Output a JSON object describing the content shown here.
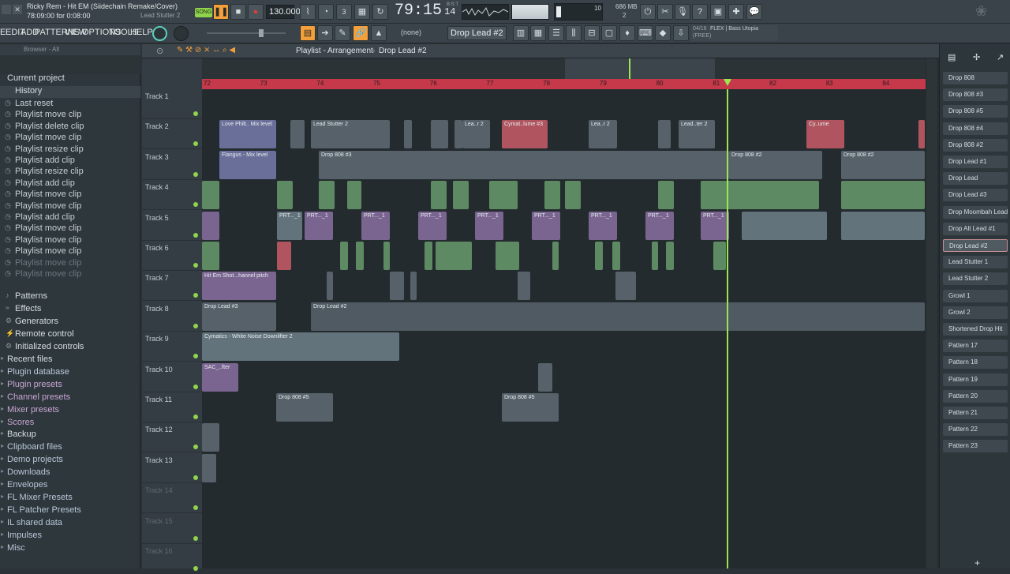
{
  "window": {
    "title": "Ricky Rem - Hit EM (Siidechain Remake/Cover)",
    "time_info": "78:09:00 for 0:08:00",
    "hint_text": "Lead Stutter 2"
  },
  "transport": {
    "mode_label": "SONG",
    "tempo": "130.000",
    "time_display": "79:15",
    "time_sub": "14",
    "time_unit": "B:S:T",
    "cpu_value": "10",
    "memory": "686 MB",
    "voices": "2"
  },
  "menu": {
    "items": [
      "E",
      "EDIT",
      "ADD",
      "PATTERNS",
      "VIEW",
      "OPTIONS",
      "TOOLS",
      "HELP"
    ]
  },
  "toolbar": {
    "preset_none": "(none)",
    "pattern_selector": "Drop Lead #2",
    "news_counter": "04/16",
    "news_text": "FLEX | Bass Utopia",
    "news_sub": "(FREE)"
  },
  "browser": {
    "header": "Browser - All",
    "current_project": "Current project",
    "history_label": "History",
    "history_items": [
      "Last reset",
      "Playlist move clip",
      "Playlist delete clip",
      "Playlist move clip",
      "Playlist resize clip",
      "Playlist add clip",
      "Playlist resize clip",
      "Playlist add clip",
      "Playlist move clip",
      "Playlist move clip",
      "Playlist add clip",
      "Playlist move clip",
      "Playlist move clip",
      "Playlist move clip",
      "Playlist move clip",
      "Playlist move clip"
    ],
    "project_items": [
      "Patterns",
      "Effects",
      "Generators",
      "Remote control",
      "Initialized controls"
    ],
    "folders": [
      "Recent files",
      "Plugin database",
      "Plugin presets",
      "Channel presets",
      "Mixer presets",
      "Scores",
      "Backup",
      "Clipboard files",
      "Demo projects",
      "Downloads",
      "Envelopes",
      "FL Mixer Presets",
      "FL Patcher Presets",
      "IL shared data",
      "Impulses",
      "Misc"
    ]
  },
  "playlist": {
    "title": "Playlist - Arrangement",
    "current_pattern": "Drop Lead #2",
    "ruler": [
      "72",
      "73",
      "74",
      "75",
      "76",
      "77",
      "78",
      "79",
      "80",
      "81",
      "82",
      "83",
      "84"
    ],
    "tracks": [
      "Track 1",
      "Track 2",
      "Track 3",
      "Track 4",
      "Track 5",
      "Track 6",
      "Track 7",
      "Track 8",
      "Track 9",
      "Track 10",
      "Track 11",
      "Track 12",
      "Track 13",
      "Track 14",
      "Track 15",
      "Track 16"
    ],
    "clip_labels": {
      "love_philt": "Love Philt.. Mix level",
      "lead_stutter_2": "Lead Stutter 2",
      "lea_r2": "Lea..r 2",
      "cymat_lume_3": "Cymat..lume #3",
      "lea_r2b": "Lea..r 2",
      "lead_ter2": "Lead..ter 2",
      "cy_ume": "Cy..ume",
      "flangus": "Flangus - Mix level",
      "drop808_3": "Drop 808 #3",
      "drop808_2a": "Drop 808 #2",
      "drop808_2b": "Drop 808 #2",
      "prt": "PRT..._1",
      "hit_em_shot": "Hit Em Shot...hannel pitch",
      "drop_lead_3": "Drop Lead #3",
      "drop_lead_2": "Drop Lead #2",
      "drop_moombah": "Drop Moombah Lead",
      "cymatics_white": "Cymatics - White Noise Downlifter 2",
      "sac_fter": "SAC_..fter",
      "drop808_5a": "Drop 808 #5",
      "drop808_5b": "Drop 808 #5"
    }
  },
  "picker": {
    "items": [
      "Drop 808",
      "Drop 808 #3",
      "Drop 808 #5",
      "Drop 808 #4",
      "Drop 808 #2",
      "Drop Lead #1",
      "Drop Lead",
      "Drop Lead #3",
      "Drop Moombah Lead",
      "Drop Alt Lead #1",
      "Drop Lead #2",
      "Lead Stutter 1",
      "Lead Stutter 2",
      "Growl 1",
      "Growl 2",
      "Shortened Drop Hit",
      "Pattern 17",
      "Pattern 18",
      "Pattern 19",
      "Pattern 20",
      "Pattern 21",
      "Pattern 22",
      "Pattern 23"
    ],
    "selected_index": 10
  },
  "colors": {
    "accent": "#f3a03a",
    "ruler": "#c6394a",
    "playhead": "#9ae653"
  }
}
